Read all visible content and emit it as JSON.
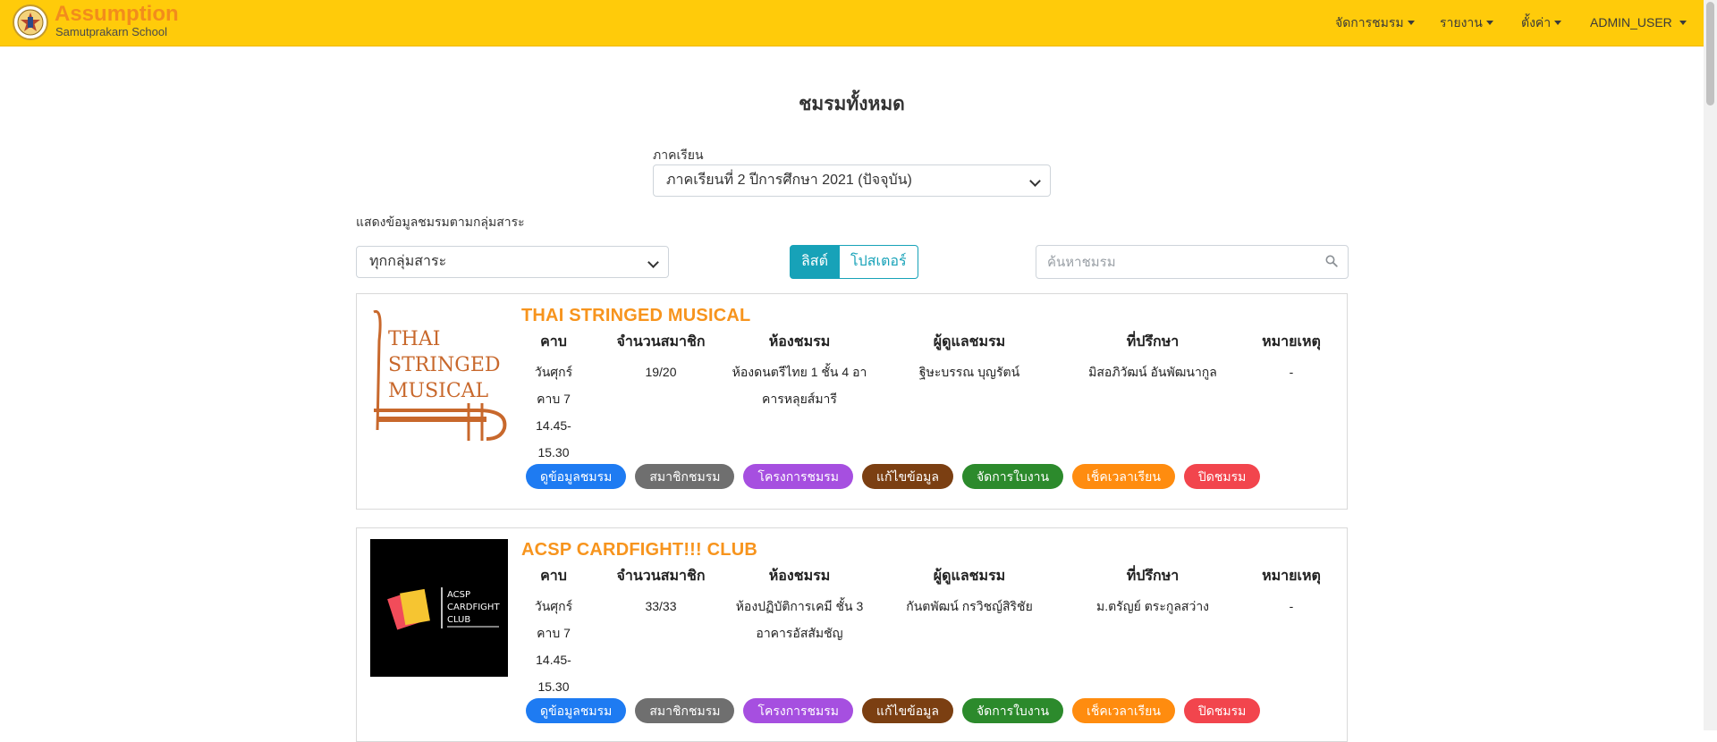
{
  "navbar": {
    "brand_name": "Assumption",
    "brand_sub": "Samutprakarn School",
    "menu": [
      "จัดการชมรม",
      "รายงาน",
      "ตั้งค่า",
      "ADMIN_USER"
    ]
  },
  "page": {
    "title": "ชมรมทั้งหมด",
    "semester_label": "ภาคเรียน",
    "semester_value": "ภาคเรียนที่ 2 ปีการศึกษา 2021 (ปัจจุบัน)",
    "group_label": "แสดงข้อมูลชมรมตามกลุ่มสาระ",
    "group_value": "ทุกกลุ่มสาระ",
    "view_list": "ลิสต์",
    "view_poster": "โปสเตอร์",
    "search_placeholder": "ค้นหาชมรม"
  },
  "columns": [
    "คาบ",
    "จำนวนสมาชิก",
    "ห้องชมรม",
    "ผู้ดูแลชมรม",
    "ที่ปรึกษา",
    "หมายเหตุ"
  ],
  "buttons": [
    "ดูข้อมูลชมรม",
    "สมาชิกชมรม",
    "โครงการชมรม",
    "แก้ไขข้อมูล",
    "จัดการใบงาน",
    "เช็คเวลาเรียน",
    "ปิดชมรม"
  ],
  "button_colors": [
    "#1e7bf2",
    "#6f6f6f",
    "#a64fe0",
    "#7b3f12",
    "#2c8a2c",
    "#ff8c0f",
    "#f2454d"
  ],
  "clubs": [
    {
      "name": "THAI STRINGED MUSICAL",
      "logo_text": [
        "THAI",
        "STRINGED",
        "MUSICAL"
      ],
      "period": [
        "วันศุกร์",
        "คาบ 7",
        "14.45-",
        "15.30"
      ],
      "members": "19/20",
      "room": [
        "ห้องดนตรีไทย 1 ชั้น 4 อา",
        "คารหลุยส์มารี"
      ],
      "supervisor": "ฐิษะบรรณ บุญรัตน์",
      "advisor": "มิสอภิวัฒน์ อันพัฒนากูล",
      "note": "-"
    },
    {
      "name": "ACSP CARDFIGHT!!! CLUB",
      "logo_text": [
        "ACSP",
        "CARDFIGHT",
        "CLUB"
      ],
      "period": [
        "วันศุกร์",
        "คาบ 7",
        "14.45-",
        "15.30"
      ],
      "members": "33/33",
      "room": [
        "ห้องปฏิบัติการเคมี ชั้น 3",
        "อาคารอัสสัมชัญ"
      ],
      "supervisor": "กันตพัฒน์ กรวิชญ์สิริชัย",
      "advisor": "ม.ตรัญย์ ตระกูลสว่าง",
      "note": "-"
    }
  ]
}
